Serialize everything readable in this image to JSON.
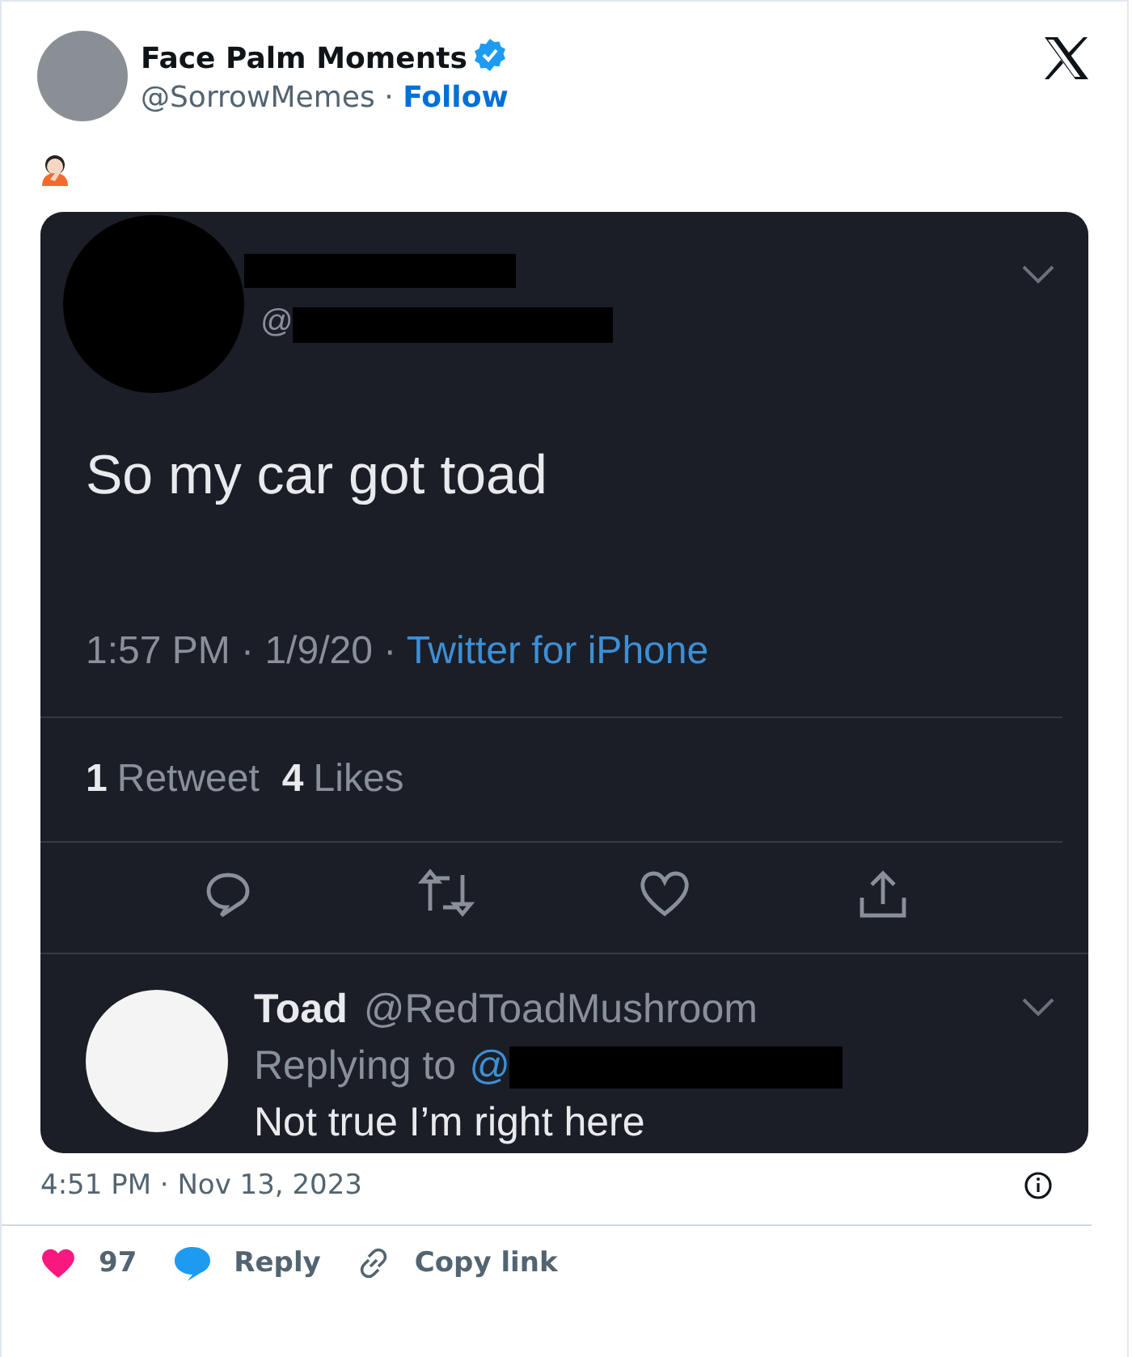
{
  "author": {
    "name": "Face Palm Moments",
    "verified": true,
    "handle": "@SorrowMemes",
    "separator": "·",
    "follow": "Follow"
  },
  "screenshot": {
    "original": {
      "at": "@",
      "text": "So my car got toad",
      "time": "1:57 PM · 1/9/20 · ",
      "source": "Twitter for iPhone",
      "retweets_count": "1",
      "retweets_label": "Retweet",
      "likes_count": "4",
      "likes_label": "Likes"
    },
    "reply": {
      "name": "Toad",
      "handle": "@RedToadMushroom",
      "replying": "Replying to",
      "at": "@",
      "text": "Not true I’m right here"
    }
  },
  "timestamp": "4:51 PM · Nov 13, 2023",
  "actions": {
    "likes": "97",
    "reply": "Reply",
    "copy": "Copy link"
  }
}
